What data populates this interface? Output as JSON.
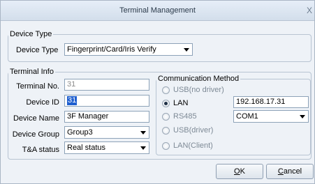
{
  "window": {
    "title": "Terminal Management",
    "close_symbol": "X"
  },
  "device_type_group": {
    "legend": "Device Type",
    "label": "Device Type",
    "value": "Fingerprint/Card/Iris Verify"
  },
  "terminal_info": {
    "legend": "Terminal Info",
    "terminal_no_label": "Terminal No.",
    "terminal_no_value": "31",
    "device_id_label": "Device ID",
    "device_id_value": "31",
    "device_name_label": "Device Name",
    "device_name_value": "3F Manager",
    "device_group_label": "Device Group",
    "device_group_value": "Group3",
    "ta_status_label": "T&A status",
    "ta_status_value": "Real status"
  },
  "communication": {
    "legend": "Communication Method",
    "options": [
      {
        "label": "USB(no driver)",
        "checked": false
      },
      {
        "label": "LAN",
        "checked": true
      },
      {
        "label": "RS485",
        "checked": false
      },
      {
        "label": "USB(driver)",
        "checked": false
      },
      {
        "label": "LAN(Client)",
        "checked": false
      }
    ],
    "ip_address": "192.168.17.31",
    "com_port": "COM1"
  },
  "buttons": {
    "ok_mnemonic": "O",
    "ok_rest": "K",
    "cancel_mnemonic": "C",
    "cancel_rest": "ancel"
  }
}
